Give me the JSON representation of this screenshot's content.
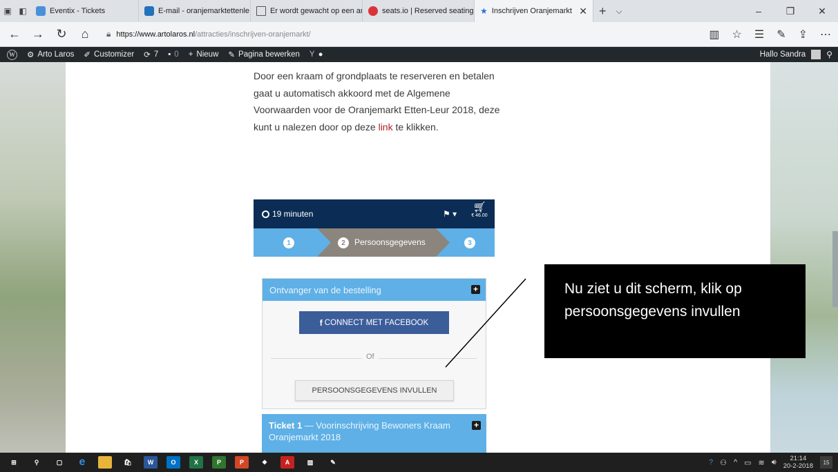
{
  "browser": {
    "tabs": [
      {
        "title": "Eventix - Tickets",
        "icon_color": "#4a90d9"
      },
      {
        "title": "E-mail - oranjemarktettenle",
        "icon_color": "#2372ba"
      },
      {
        "title": "Er wordt gewacht op een ar",
        "icon_color": "#555555"
      },
      {
        "title": "seats.io | Reserved seating f",
        "icon_color": "#d9343a"
      },
      {
        "title": "Inschrijven Oranjemarkt",
        "icon_color": "#2b6ed6"
      }
    ],
    "new_tab": "+",
    "tab_dropdown": "⌵",
    "close_tab": "✕",
    "url_domain": "https://www.artolaros.nl",
    "url_path": "/attracties/inschrijven-oranjemarkt/",
    "win_minimize": "–",
    "win_restore": "❐",
    "win_close": "✕"
  },
  "wpbar": {
    "site": "Arto Laros",
    "customizer": "Customizer",
    "updates": "7",
    "comments": "0",
    "new": "Nieuw",
    "edit": "Pagina bewerken",
    "greeting": "Hallo Sandra"
  },
  "page": {
    "para_before": "Door een kraam of grondplaats te reserveren en betalen gaat u automatisch akkoord met de Algemene Voorwaarden voor de Oranjemarkt Etten-Leur 2018, deze kunt u nalezen door op deze ",
    "link": "link",
    "para_after": " te klikken."
  },
  "widget": {
    "timer": "19 minuten",
    "cart_total": "€ 46.00",
    "step1": "1",
    "step2": "2",
    "step2_label": "Persoonsgegevens",
    "step3": "3",
    "recipient_header": "Ontvanger van de bestelling",
    "fb_button": "CONNECT MET FACEBOOK",
    "or": "Of",
    "personal_button": "PERSOONSGEGEVENS INVULLEN",
    "ticket_title": "Ticket 1",
    "ticket_desc": " — Voorinschrijving Bewoners Kraam Oranjemarkt 2018"
  },
  "annotation": {
    "text": "Nu ziet u dit scherm, klik op persoonsgegevens invullen"
  },
  "taskbar": {
    "time": "21:14",
    "date": "20-2-2018",
    "notifications": "15"
  },
  "colors": {
    "widget_dark": "#0b2c54",
    "widget_light": "#5fb0e6",
    "step_active": "#8b857d",
    "facebook": "#3b5d9a",
    "link": "#b3202a"
  }
}
